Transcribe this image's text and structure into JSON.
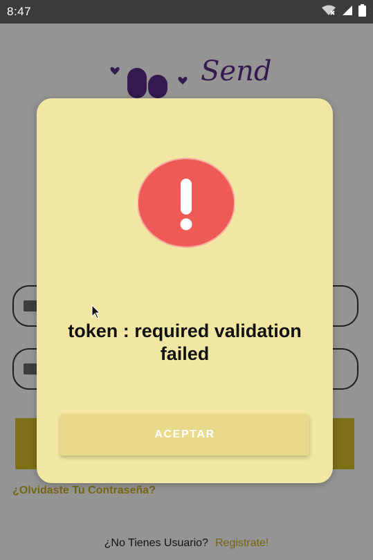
{
  "status_bar": {
    "time": "8:47",
    "icons": [
      "wifi-off-icon",
      "cellular-signal-icon",
      "battery-icon"
    ]
  },
  "background_app": {
    "logo_text": "Send",
    "forgot_password": "¿Olvidaste Tu Contraseña?",
    "register_prompt": "¿No Tienes Usuario?",
    "register_link": "Registrate!"
  },
  "dialog": {
    "icon": "alert-exclamation-icon",
    "message": "token : required validation failed",
    "accept_label": "ACEPTAR"
  },
  "colors": {
    "dialog_bg": "#f1e6a2",
    "alert_red": "#ee5b57",
    "accept_button": "#e9d98b",
    "brand_purple": "#5a2d88",
    "accent_yellow": "#c9b01e"
  }
}
